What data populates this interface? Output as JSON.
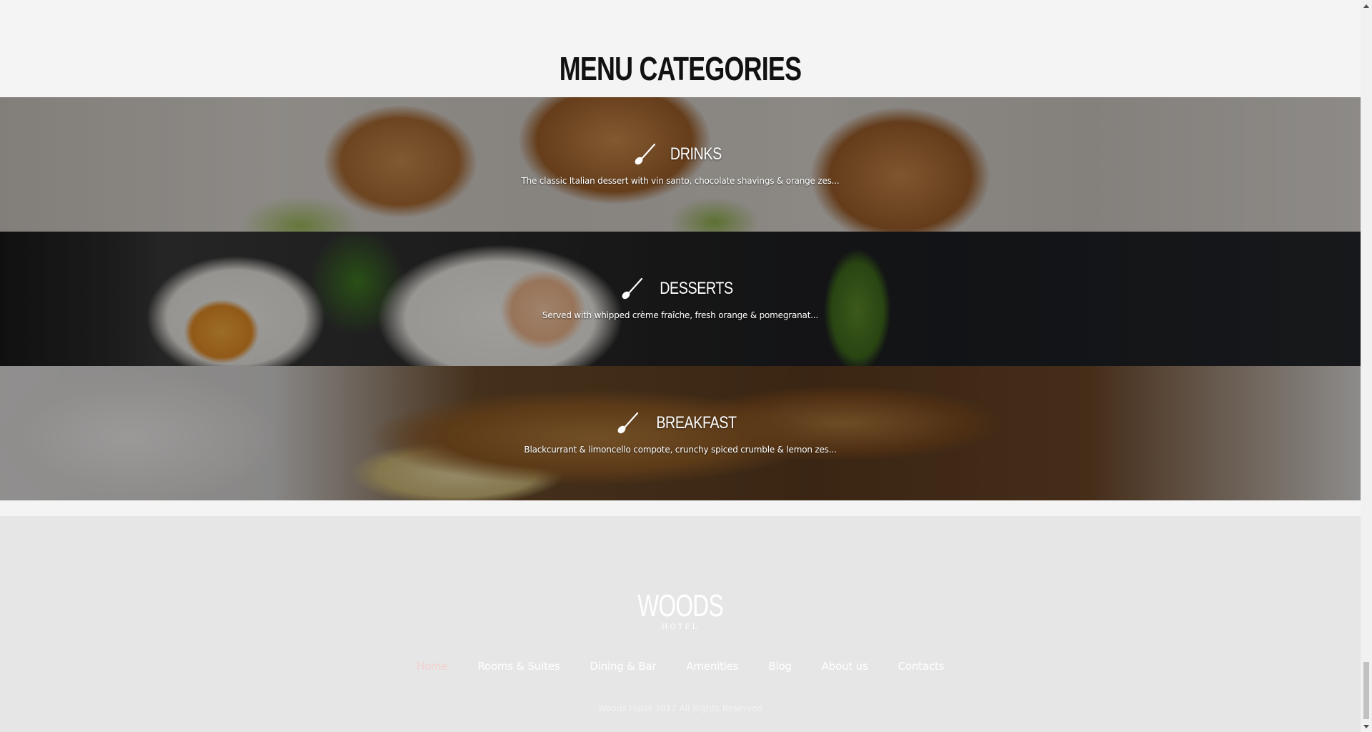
{
  "section": {
    "title": "MENU CATEGORIES"
  },
  "categories": [
    {
      "name": "DRINKS",
      "description": "The classic Italian dessert with vin santo, chocolate shavings & orange zes...",
      "icon": "spoon-icon"
    },
    {
      "name": "DESSERTS",
      "description": "Served with whipped crème fraîche, fresh orange & pomegranat...",
      "icon": "spoon-icon"
    },
    {
      "name": "BREAKFAST",
      "description": "Blackcurrant & limoncello compote, crunchy spiced crumble & lemon zes...",
      "icon": "spoon-icon"
    }
  ],
  "footer": {
    "logo": "WOODS",
    "logo_sub": "HOTEL",
    "nav": [
      {
        "label": "Home",
        "active": true
      },
      {
        "label": "Rooms & Suites",
        "active": false
      },
      {
        "label": "Dining & Bar",
        "active": false
      },
      {
        "label": "Amenities",
        "active": false
      },
      {
        "label": "Blog",
        "active": false
      },
      {
        "label": "About us",
        "active": false
      },
      {
        "label": "Contacts",
        "active": false
      }
    ],
    "copyright": "Woods Hotel 2017 All Rights Reserved"
  },
  "colors": {
    "background": "#f4f4f4",
    "footer_bg": "#e6e6e6",
    "active_nav": "#f3cfcf",
    "title": "#111111"
  }
}
